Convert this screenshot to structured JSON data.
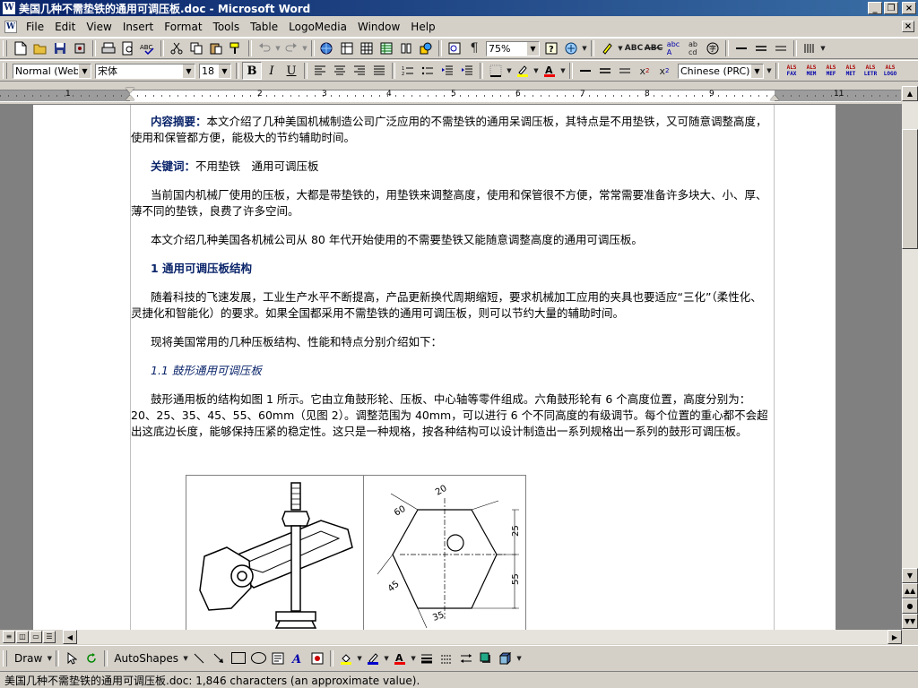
{
  "window": {
    "title": "美国几种不需垫铁的通用可调压板.doc - Microsoft Word",
    "app_icon": "W",
    "minimize": "_",
    "restore": "❐",
    "close": "×"
  },
  "menu": {
    "items": [
      "File",
      "Edit",
      "View",
      "Insert",
      "Format",
      "Tools",
      "Table",
      "LogoMedia",
      "Window",
      "Help"
    ],
    "doc_close": "×"
  },
  "toolbar": {
    "zoom": "75%"
  },
  "format_bar": {
    "style": "Normal (Web)",
    "font": "宋体",
    "size": "18",
    "language": "Chinese (PRC)",
    "bold": "B",
    "italic": "I",
    "underline": "U",
    "als_buttons": [
      [
        "ALS",
        "FAX"
      ],
      [
        "ALS",
        "MEM"
      ],
      [
        "ALS",
        "MEF"
      ],
      [
        "ALS",
        "MET"
      ],
      [
        "ALS",
        "LETR"
      ],
      [
        "ALS",
        "LOGO"
      ]
    ]
  },
  "ruler": {
    "numbers": [
      "1",
      "2",
      "3",
      "4",
      "5",
      "6",
      "7",
      "8",
      "9",
      "11"
    ]
  },
  "document": {
    "abstract_label": "内容摘要：",
    "abstract_text": "本文介绍了几种美国机械制造公司广泛应用的不需垫铁的通用呆调压板，其特点是不用垫铁，又可随意调整高度，使用和保管都方便，能极大的节约辅助时间。",
    "keywords_label": "关键词：",
    "keywords_text": "不用垫铁　通用可调压板",
    "para1": "当前国内机械厂使用的压板，大都是带垫铁的，用垫铁来调整高度，使用和保管很不方便，常常需要准备许多块大、小、厚、薄不同的垫铁，良费了许多空间。",
    "para2": "本文介绍几种美国各机械公司从 80 年代开始使用的不需要垫铁又能随意调整高度的通用可调压板。",
    "heading1": "1 通用可调压板结构",
    "para3": "随着科技的飞速发展，工业生产水平不断提高，产品更新换代周期缩短，要求机械加工应用的夹具也要适应“三化”（柔性化、灵捷化和智能化）的要求。如果全国都采用不需垫铁的通用可调压板，则可以节约大量的辅助时间。",
    "para4": "现将美国常用的几种压板结构、性能和特点分别介绍如下：",
    "heading2": "1.1 鼓形通用可调压板",
    "para5": "鼓形通用板的结构如图 1 所示。它由立角鼓形轮、压板、中心轴等零件组成。六角鼓形轮有 6 个高度位置，高度分别为：20、25、35、45、55、60mm（见图 2）。调整范围为 40mm，可以进行 6 个不同高度的有级调节。每个位置的重心都不会超出这底边长度，能够保持压紧的稳定性。这只是一种规格，按各种结构可以设计制造出一系列规格出一系列的鼓形可调压板。",
    "figure_labels": [
      "20",
      "60",
      "25",
      "55",
      "45",
      "35"
    ]
  },
  "drawbar": {
    "draw": "Draw",
    "autoshapes": "AutoShapes"
  },
  "status": {
    "text": "美国几种不需垫铁的通用可调压板.doc: 1,846 characters (an approximate value)."
  }
}
